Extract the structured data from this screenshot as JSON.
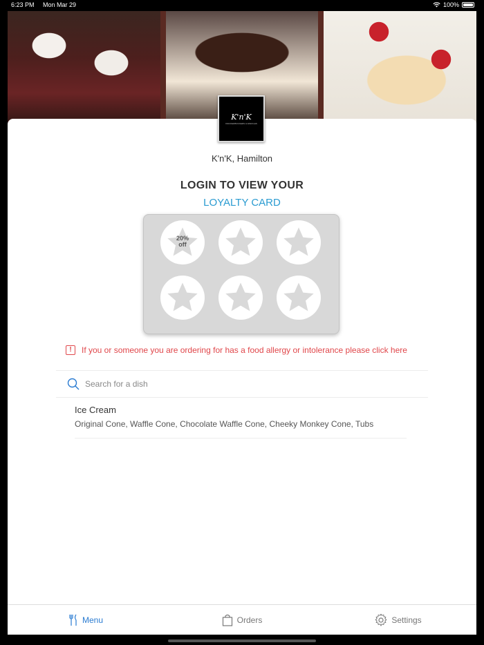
{
  "status_bar": {
    "time": "6:23 PM",
    "date": "Mon Mar 29",
    "battery": "100%"
  },
  "store": {
    "name": "K'n'K, Hamilton",
    "logo_text": "K'n'K",
    "logo_subtext": "KNICKERBOCKERS & WAFFLES"
  },
  "loyalty": {
    "title": "LOGIN TO VIEW YOUR",
    "link": "LOYALTY CARD",
    "stamps": [
      {
        "label_line1": "20%",
        "label_line2": "off"
      },
      {
        "label_line1": "",
        "label_line2": ""
      },
      {
        "label_line1": "",
        "label_line2": ""
      },
      {
        "label_line1": "",
        "label_line2": ""
      },
      {
        "label_line1": "",
        "label_line2": ""
      },
      {
        "label_line1": "",
        "label_line2": ""
      }
    ]
  },
  "allergy": {
    "text": "If you or someone you are ordering for has a food allergy or intolerance please click here",
    "icon": "!"
  },
  "search": {
    "placeholder": "Search for a dish"
  },
  "categories": [
    {
      "title": "Ice Cream",
      "items": "Original Cone, Waffle Cone, Chocolate Waffle Cone, Cheeky Monkey Cone, Tubs"
    }
  ],
  "tabs": [
    {
      "label": "Menu",
      "icon": "fork-knife-icon",
      "active": true
    },
    {
      "label": "Orders",
      "icon": "bag-icon",
      "active": false
    },
    {
      "label": "Settings",
      "icon": "gear-icon",
      "active": false
    }
  ],
  "colors": {
    "accent": "#2a9bd1",
    "active_tab": "#2a7bd1",
    "alert": "#e0464a"
  }
}
